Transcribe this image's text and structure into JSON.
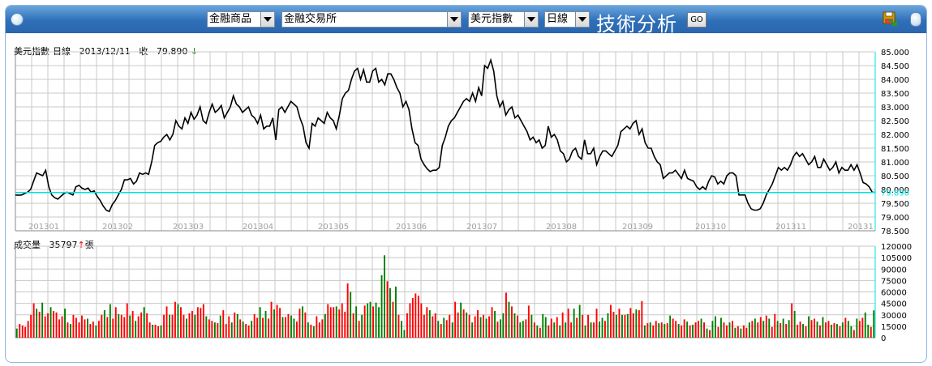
{
  "toolbar": {
    "category": "金融商品",
    "exchange": "金融交易所",
    "symbol": "美元指數",
    "period": "日線",
    "title": "技術分析",
    "go_label": "GO"
  },
  "price_panel": {
    "name": "美元指數-日線",
    "date": "2013/12/11",
    "close_label": "收",
    "close_value": "79.890",
    "arrow": "↓",
    "arrow_color": "#008000"
  },
  "volume_panel": {
    "name": "成交量",
    "value": "35797",
    "arrow": "↑",
    "unit": "張",
    "arrow_color": "#ff0000"
  },
  "colors": {
    "up": "#ff0000",
    "down": "#008000",
    "line": "#000000",
    "last_price_line": "#00e0e0",
    "grid": "#c8c8c8",
    "bar_top": "#3b7fc9"
  },
  "chart_data": [
    {
      "type": "line",
      "title": "美元指數-日線",
      "ylim": [
        78.5,
        85.0
      ],
      "y_ticks": [
        "85.000",
        "84.500",
        "84.000",
        "83.500",
        "83.000",
        "82.500",
        "82.000",
        "81.500",
        "81.000",
        "80.500",
        "80.000",
        "79.500",
        "79.000",
        "78.500"
      ],
      "x_tick_labels": [
        "201301",
        "201302",
        "201303",
        "201304",
        "201305",
        "201306",
        "201307",
        "201308",
        "201309",
        "201310",
        "201311",
        "20131"
      ],
      "last_value": 79.89,
      "last_value_label": "79.890",
      "grid": true,
      "values": [
        79.8,
        79.79,
        79.8,
        79.85,
        79.9,
        80.0,
        80.3,
        80.6,
        80.55,
        80.5,
        80.7,
        80.1,
        79.8,
        79.7,
        79.65,
        79.75,
        79.85,
        79.9,
        79.85,
        79.8,
        80.1,
        80.15,
        80.05,
        80.0,
        80.05,
        79.9,
        79.95,
        79.75,
        79.6,
        79.4,
        79.25,
        79.2,
        79.45,
        79.6,
        79.8,
        80.0,
        80.35,
        80.35,
        80.4,
        80.2,
        80.3,
        80.6,
        80.55,
        80.6,
        80.55,
        81.0,
        81.6,
        81.7,
        81.75,
        81.9,
        82.0,
        81.8,
        82.0,
        82.5,
        82.3,
        82.2,
        82.6,
        82.4,
        82.8,
        82.55,
        82.7,
        83.0,
        82.5,
        82.4,
        82.8,
        83.1,
        82.8,
        82.9,
        83.05,
        82.6,
        82.8,
        83.0,
        83.4,
        83.1,
        83.0,
        82.8,
        82.9,
        83.0,
        82.7,
        82.6,
        82.4,
        82.7,
        82.2,
        82.3,
        82.3,
        82.6,
        81.8,
        82.9,
        83.0,
        82.8,
        83.0,
        83.2,
        83.1,
        83.0,
        82.6,
        82.3,
        81.7,
        81.5,
        82.4,
        82.3,
        82.6,
        82.5,
        82.4,
        82.8,
        82.6,
        82.5,
        82.2,
        82.7,
        83.3,
        83.5,
        83.6,
        84.0,
        84.3,
        84.4,
        84.0,
        84.35,
        83.9,
        83.9,
        84.3,
        84.4,
        83.9,
        84.0,
        83.8,
        84.2,
        84.2,
        84.0,
        83.7,
        83.5,
        83.0,
        83.2,
        82.9,
        82.2,
        81.7,
        81.6,
        81.1,
        80.9,
        80.75,
        80.65,
        80.7,
        80.7,
        80.8,
        81.6,
        81.9,
        82.3,
        82.5,
        82.6,
        82.8,
        83.0,
        83.2,
        83.3,
        83.2,
        83.5,
        83.2,
        83.7,
        83.4,
        84.5,
        84.4,
        84.7,
        84.3,
        83.4,
        83.0,
        83.2,
        82.7,
        82.9,
        83.0,
        82.6,
        82.7,
        82.5,
        82.3,
        82.1,
        81.8,
        81.9,
        81.7,
        81.8,
        81.5,
        81.6,
        82.3,
        81.9,
        82.0,
        81.8,
        81.4,
        81.3,
        81.0,
        81.1,
        81.4,
        81.5,
        81.2,
        81.1,
        81.8,
        81.3,
        81.3,
        81.5,
        80.9,
        81.2,
        81.4,
        81.4,
        81.3,
        81.2,
        81.4,
        81.6,
        82.1,
        82.2,
        82.3,
        82.2,
        82.4,
        82.5,
        82.0,
        82.2,
        81.7,
        81.5,
        81.5,
        81.2,
        81.0,
        80.9,
        80.4,
        80.5,
        80.6,
        80.6,
        80.7,
        80.55,
        80.4,
        80.7,
        80.4,
        80.35,
        80.3,
        80.1,
        80.0,
        80.1,
        80.0,
        80.3,
        80.5,
        80.45,
        80.2,
        80.3,
        80.2,
        80.5,
        80.6,
        80.6,
        80.5,
        79.8,
        79.8,
        79.8,
        79.5,
        79.3,
        79.25,
        79.25,
        79.3,
        79.5,
        79.8,
        80.0,
        80.2,
        80.5,
        80.8,
        80.7,
        80.8,
        80.7,
        80.9,
        81.2,
        81.35,
        81.2,
        81.3,
        81.1,
        80.9,
        81.0,
        81.2,
        80.8,
        80.8,
        81.1,
        80.9,
        80.7,
        80.8,
        81.0,
        80.6,
        80.8,
        80.7,
        80.7,
        80.9,
        80.7,
        80.9,
        80.6,
        80.25,
        80.2,
        80.1,
        79.9,
        79.89
      ]
    },
    {
      "type": "bar",
      "title": "成交量",
      "ylim": [
        0,
        120000
      ],
      "y_ticks": [
        "120000",
        "105000",
        "90000",
        "75000",
        "60000",
        "45000",
        "30000",
        "15000",
        "0"
      ],
      "values": [
        12000,
        18000,
        16000,
        14000,
        22000,
        30000,
        45000,
        38000,
        34000,
        46000,
        28000,
        32000,
        40000,
        35000,
        33000,
        24000,
        28000,
        38000,
        20000,
        18000,
        30000,
        26000,
        20000,
        29000,
        24000,
        25000,
        18000,
        21000,
        16000,
        22000,
        30000,
        36000,
        27000,
        44000,
        25000,
        40000,
        31000,
        30000,
        27000,
        45000,
        29000,
        35000,
        22000,
        28000,
        33000,
        40000,
        32000,
        20000,
        17000,
        17000,
        15000,
        16000,
        30000,
        41000,
        30000,
        30000,
        47000,
        44000,
        40000,
        30000,
        25000,
        32000,
        35000,
        30000,
        40000,
        39000,
        44000,
        28000,
        24000,
        22000,
        20000,
        19000,
        29000,
        36000,
        18000,
        28000,
        20000,
        33000,
        31000,
        24000,
        21000,
        18000,
        16000,
        22000,
        31000,
        26000,
        40000,
        26000,
        35000,
        25000,
        47000,
        37000,
        43000,
        39000,
        27000,
        27000,
        31000,
        29000,
        25000,
        21000,
        38000,
        41000,
        33000,
        20000,
        17000,
        15000,
        28000,
        20000,
        24000,
        31000,
        44000,
        40000,
        40000,
        41000,
        37000,
        45000,
        34000,
        71000,
        60000,
        32000,
        41000,
        22000,
        30000,
        42000,
        45000,
        47000,
        41000,
        46000,
        40000,
        82000,
        108000,
        74000,
        65000,
        47000,
        67000,
        30000,
        22000,
        10000,
        32000,
        45000,
        52000,
        58000,
        55000,
        45000,
        30000,
        40000,
        36000,
        28000,
        32000,
        22000,
        18000,
        26000,
        23000,
        30000,
        20000,
        47000,
        33000,
        46000,
        37000,
        33000,
        30000,
        20000,
        28000,
        36000,
        27000,
        30000,
        25000,
        28000,
        40000,
        35000,
        21000,
        24000,
        32000,
        59000,
        47000,
        41000,
        32000,
        29000,
        20000,
        22000,
        24000,
        42000,
        30000,
        20000,
        16000,
        13000,
        31000,
        27000,
        16000,
        25000,
        20000,
        27000,
        16000,
        33000,
        20000,
        38000,
        20000,
        38000,
        26000,
        43000,
        30000,
        16000,
        30000,
        20000,
        20000,
        38000,
        21000,
        26000,
        22000,
        32000,
        43000,
        34000,
        30000,
        38000,
        30000,
        30000,
        31000,
        39000,
        32000,
        37000,
        36000,
        48000,
        16000,
        19000,
        20000,
        16000,
        22000,
        19000,
        20000,
        18000,
        19000,
        29000,
        25000,
        22000,
        18000,
        16000,
        24000,
        21000,
        16000,
        17000,
        20000,
        22000,
        25000,
        20000,
        12000,
        10000,
        22000,
        28000,
        14000,
        26000,
        20000,
        16000,
        20000,
        22000,
        13000,
        15000,
        12000,
        16000,
        13000,
        20000,
        22000,
        25000,
        20000,
        27000,
        22000,
        29000,
        25000,
        14000,
        31000,
        22000,
        19000,
        25000,
        18000,
        23000,
        45000,
        35000,
        17000,
        21000,
        18000,
        15000,
        28000,
        23000,
        25000,
        21000,
        16000,
        27000,
        20000,
        22000,
        17000,
        19000,
        18000,
        15000,
        20000,
        26000,
        22000,
        15000,
        10000,
        25000,
        22000,
        26000,
        33000,
        17000,
        14000,
        35797
      ],
      "up": [
        false,
        true,
        true,
        true,
        true,
        true,
        true,
        false,
        true,
        false,
        true,
        true,
        false,
        true,
        true,
        true,
        true,
        false,
        true,
        false,
        true,
        true,
        true,
        true,
        true,
        false,
        true,
        true,
        false,
        true,
        true,
        false,
        true,
        false,
        true,
        true,
        false,
        true,
        true,
        true,
        false,
        true,
        false,
        true,
        true,
        false,
        true,
        true,
        false,
        true,
        true,
        false,
        true,
        true,
        false,
        true,
        true,
        false,
        true,
        true,
        false,
        true,
        true,
        false,
        true,
        true,
        true,
        false,
        true,
        true,
        false,
        true,
        false,
        true,
        true,
        true,
        false,
        true,
        false,
        true,
        false,
        true,
        true,
        false,
        true,
        true,
        false,
        true,
        false,
        true,
        true,
        false,
        true,
        true,
        false,
        true,
        true,
        false,
        false,
        true,
        true,
        false,
        true,
        false,
        true,
        false,
        true,
        true,
        true,
        false,
        true,
        true,
        true,
        false,
        true,
        true,
        true,
        true,
        false,
        true,
        false,
        true,
        false,
        true,
        false,
        false,
        true,
        false,
        false,
        false,
        false,
        true,
        false,
        true,
        false,
        true,
        false,
        false,
        true,
        true,
        true,
        true,
        true,
        true,
        true,
        true,
        false,
        true,
        true,
        false,
        true,
        false,
        true,
        true,
        false,
        true,
        true,
        false,
        true,
        false,
        true,
        false,
        true,
        true,
        false,
        true,
        false,
        true,
        true,
        false,
        true,
        false,
        false,
        true,
        false,
        true,
        false,
        true,
        false,
        false,
        true,
        true,
        false,
        true,
        false,
        true,
        false,
        false,
        true,
        true,
        false,
        true,
        false,
        true,
        false,
        true,
        true,
        false,
        true,
        false,
        true,
        false,
        true,
        false,
        true,
        true,
        false,
        false,
        true,
        false,
        true,
        true,
        false,
        true,
        false,
        true,
        false,
        true,
        true,
        false,
        true,
        true,
        false,
        true,
        false,
        true,
        true,
        false,
        true,
        false,
        true,
        false,
        true,
        true,
        false,
        true,
        true,
        false,
        true,
        false,
        true,
        true,
        false,
        true,
        false,
        true,
        false,
        false,
        true,
        false,
        true,
        true,
        false,
        true,
        false,
        true,
        false,
        true,
        true,
        false,
        true,
        false,
        true,
        true,
        false,
        true,
        false,
        true,
        true,
        false,
        true,
        false,
        true,
        false,
        true,
        false,
        true,
        true,
        false,
        true,
        false,
        true,
        true,
        false,
        true,
        false,
        true,
        true,
        false,
        true,
        false,
        true,
        false,
        true,
        false,
        false,
        true,
        false,
        true,
        true,
        false,
        false,
        true,
        false,
        true,
        false,
        true,
        false,
        false,
        true,
        false,
        true,
        false,
        true,
        false,
        true,
        false,
        true,
        true,
        false,
        false,
        true,
        false
      ]
    }
  ]
}
